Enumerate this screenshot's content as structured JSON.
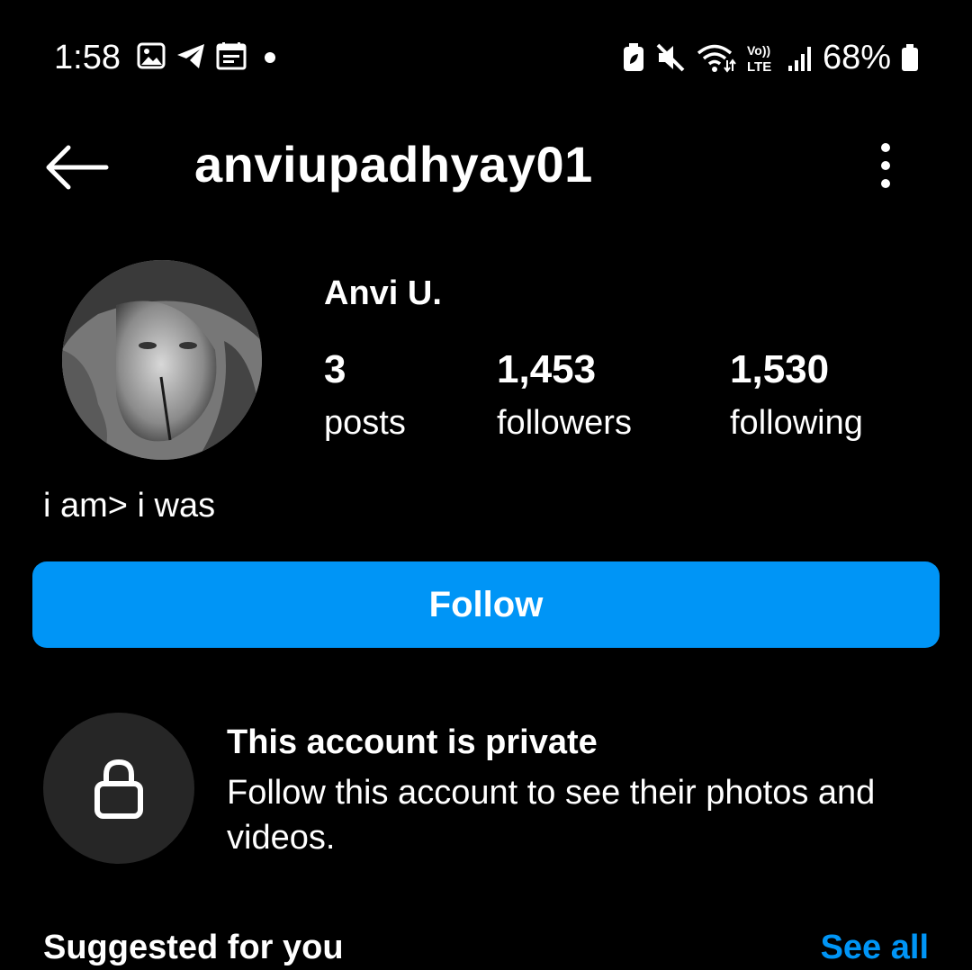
{
  "status_bar": {
    "time": "1:58",
    "battery_percent": "68%",
    "left_icons": [
      "gallery-icon",
      "telegram-icon",
      "calendar-icon",
      "dot-icon"
    ],
    "right_icons": [
      "battery-saver-icon",
      "mute-icon",
      "wifi-icon",
      "volte-icon",
      "signal-icon",
      "battery-icon"
    ]
  },
  "header": {
    "username": "anviupadhyay01"
  },
  "profile": {
    "display_name": "Anvi U.",
    "stats": [
      {
        "value": "3",
        "label": "posts"
      },
      {
        "value": "1,453",
        "label": "followers"
      },
      {
        "value": "1,530",
        "label": "following"
      }
    ],
    "bio": "i am> i was"
  },
  "actions": {
    "follow_label": "Follow"
  },
  "private_notice": {
    "title": "This account is private",
    "description": "Follow this account to see their photos and videos."
  },
  "suggested": {
    "title": "Suggested for you",
    "see_all": "See all"
  },
  "colors": {
    "background": "#000000",
    "accent": "#0095f6",
    "lock_circle": "#262626"
  }
}
